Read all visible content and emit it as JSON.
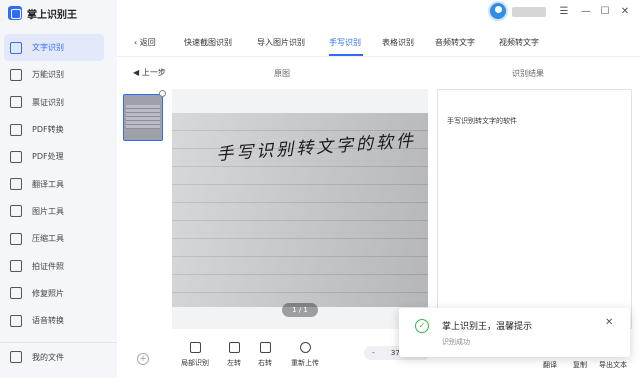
{
  "app": {
    "name": "掌上识别王"
  },
  "sidebar": {
    "items": [
      {
        "label": "文字识别",
        "icon": "text-recognition-icon"
      },
      {
        "label": "万能识别",
        "icon": "universal-recognition-icon"
      },
      {
        "label": "票证识别",
        "icon": "ticket-recognition-icon"
      },
      {
        "label": "PDF转换",
        "icon": "pdf-convert-icon"
      },
      {
        "label": "PDF处理",
        "icon": "pdf-process-icon"
      },
      {
        "label": "翻译工具",
        "icon": "translate-icon"
      },
      {
        "label": "图片工具",
        "icon": "image-tools-icon"
      },
      {
        "label": "压缩工具",
        "icon": "compress-icon"
      },
      {
        "label": "拍证件照",
        "icon": "id-photo-icon"
      },
      {
        "label": "修复照片",
        "icon": "repair-photo-icon"
      },
      {
        "label": "语音转换",
        "icon": "voice-convert-icon"
      }
    ],
    "my_files": "我的文件"
  },
  "tabs": {
    "back": "返回",
    "items": [
      "快速截图识别",
      "导入图片识别",
      "手写识别",
      "表格识别",
      "音频转文字",
      "视频转文字"
    ],
    "active": "手写识别"
  },
  "toolbar": {
    "prev": "上一步",
    "original_title": "原图",
    "result_title": "识别结果"
  },
  "image": {
    "handwriting": "手写识别转文字的软件",
    "pager": "1 / 1"
  },
  "result": {
    "text": "手写识别转文字的软件"
  },
  "controls": {
    "partial": "局部识别",
    "rotate_left": "左转",
    "rotate_right": "右转",
    "reupload": "重新上传",
    "zoom_minus": "-",
    "zoom_value": "37",
    "zoom_plus": "+"
  },
  "bottom_links": {
    "translate": "翻译",
    "copy": "复制",
    "export": "导出文本"
  },
  "toast": {
    "title": "掌上识别王，温馨提示",
    "message": "识别成功",
    "close": "✕"
  },
  "colors": {
    "accent": "#2f6cf5",
    "success": "#39b54a"
  }
}
